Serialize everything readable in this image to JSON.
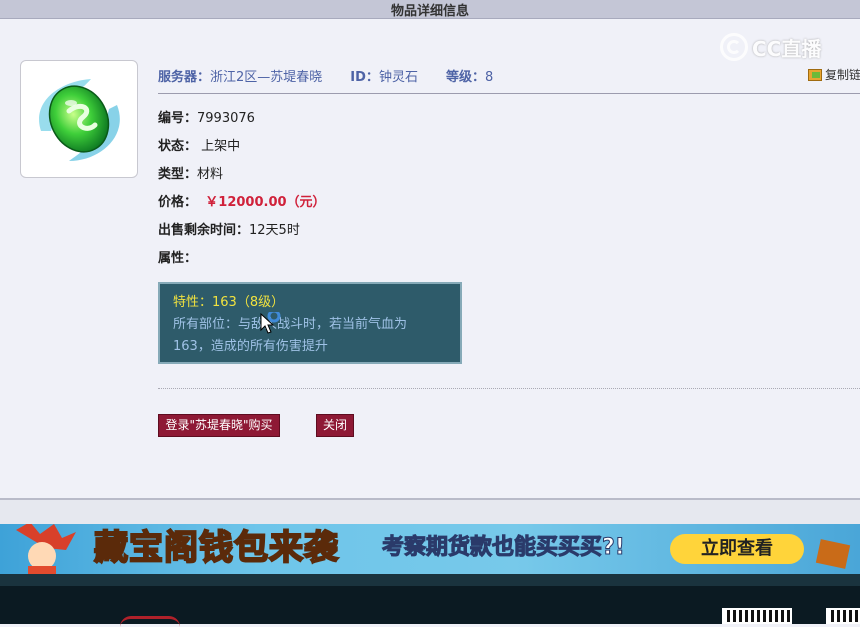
{
  "page": {
    "title": "物品详细信息"
  },
  "watermark": {
    "text": "CC直播"
  },
  "item": {
    "server_label": "服务器：",
    "server_value": "浙江2区—苏堤春晓",
    "id_label": "ID：",
    "id_value": "钟灵石",
    "level_label": "等级：",
    "level_value": "8",
    "copy_label": "复制链"
  },
  "details": {
    "number_label": "编号：",
    "number_value": "7993076",
    "status_label": "状态：",
    "status_value": "上架中",
    "type_label": "类型：",
    "type_value": "材料",
    "price_label": "价格：",
    "price_value": "￥12000.00（元）",
    "time_label": "出售剩余时间：",
    "time_value": "12天5时",
    "attr_label": "属性："
  },
  "attribute": {
    "line1": "特性：163（8级）",
    "line2": "所有部位：与敌人战斗时，若当前气血为",
    "line3": "163，造成的所有伤害提升"
  },
  "buttons": {
    "buy": "登录\"苏堤春晓\"购买",
    "close": "关闭"
  },
  "banner": {
    "title": "藏宝阁钱包来袭",
    "subtitle": "考察期货款也能买买买?!",
    "cta": "立即查看"
  },
  "colors": {
    "accent_blue": "#4e63a6",
    "price_red": "#d0213a",
    "button_bg": "#8e1935",
    "attr_bg": "#2e5b6a",
    "attr_highlight": "#f1e23f"
  }
}
